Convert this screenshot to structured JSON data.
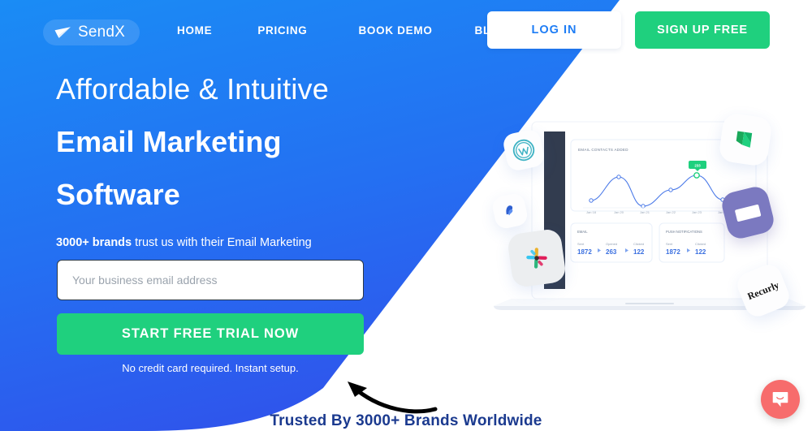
{
  "brand": {
    "name": "SendX",
    "logo_icon": "paper-plane-icon",
    "blue_top": "#1a8cf5",
    "blue_bottom": "#2f55ec",
    "green": "#1fd07e",
    "dark_blue_text": "#1b3a8f"
  },
  "nav": {
    "items": [
      {
        "label": "HOME"
      },
      {
        "label": "PRICING"
      },
      {
        "label": "BOOK DEMO"
      },
      {
        "label": "BLOG"
      }
    ],
    "login_label": "LOG IN",
    "signup_label": "SIGN UP FREE"
  },
  "hero": {
    "headline_line1": "Affordable & Intuitive",
    "headline_line2": "Email Marketing",
    "headline_line3": "Software",
    "subtitle_bold": "3000+ brands",
    "subtitle_rest": " trust us with their Email Marketing",
    "email_placeholder": "Your business email address",
    "email_value": "",
    "cta_label": "START FREE TRIAL NOW",
    "note": "No credit card required. Instant setup.",
    "trusted_label": "Trusted By 3000+ Brands Worldwide",
    "arrow_icon": "curved-arrow-icon"
  },
  "illustration": {
    "device": "laptop-mockup",
    "dashboard": {
      "chart_card_title": "Email Contacts Added",
      "tooltip_value": "233",
      "cards": [
        {
          "title": "Email",
          "stats": [
            {
              "label": "Sent",
              "value": "1872"
            },
            {
              "label": "Opened",
              "value": "263"
            },
            {
              "label": "Clicked",
              "value": "122"
            }
          ]
        },
        {
          "title": "Push Notifications",
          "stats": [
            {
              "label": "Sent",
              "value": "1872"
            },
            {
              "label": "Clicked",
              "value": "122"
            }
          ]
        }
      ]
    },
    "badges": [
      {
        "name": "wordpress-icon",
        "label": ""
      },
      {
        "name": "blue-app-icon",
        "label": ""
      },
      {
        "name": "slack-icon",
        "label": ""
      },
      {
        "name": "green-app-icon",
        "label": ""
      },
      {
        "name": "purple-app-icon",
        "label": ""
      },
      {
        "name": "recurly-badge",
        "label": "Recurly"
      }
    ]
  },
  "chart_data": {
    "type": "line",
    "title": "Email Contacts Added",
    "x": [
      "Jan 18",
      "Jan 20",
      "Jan 21",
      "Jan 22",
      "Jan 23",
      "Jan 24"
    ],
    "values": [
      28,
      62,
      18,
      42,
      72,
      22
    ],
    "xlabel": "",
    "ylabel": "",
    "ylim": [
      0,
      100
    ],
    "grid": false,
    "legend": "none",
    "highlight_point": {
      "x": "Jan 23",
      "value": 72,
      "tooltip": "233"
    },
    "line_color": "#4a79e8"
  },
  "chat": {
    "icon": "chat-bubble-icon",
    "color": "#f76c6c"
  }
}
